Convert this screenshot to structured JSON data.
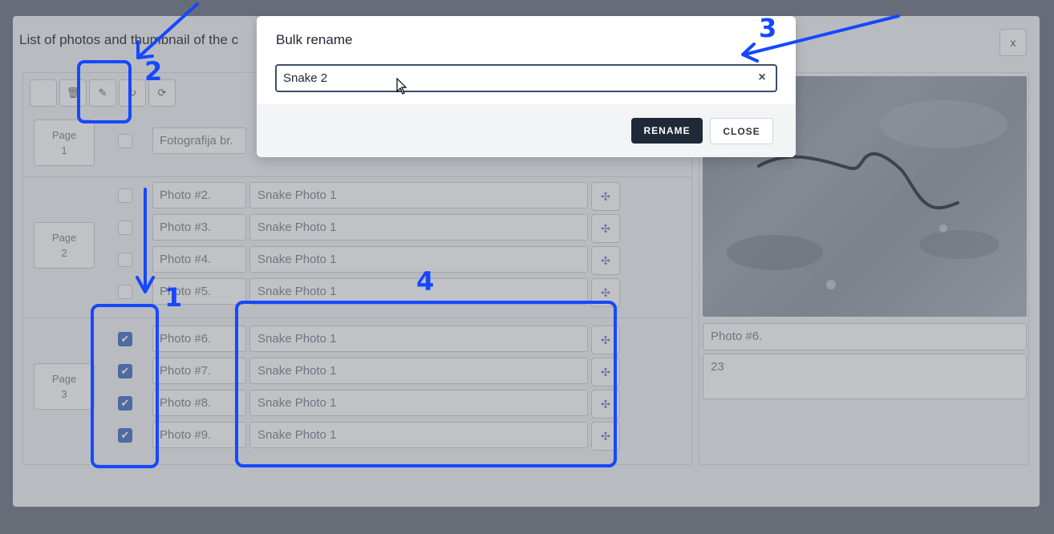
{
  "background_modal": {
    "title": "List of photos and thumbnail of the c",
    "close_label": "x",
    "toolbar_icons": [
      "blank",
      "trash-icon",
      "edit-icon",
      "rotate-icon",
      "refresh-icon"
    ],
    "header_row": {
      "photo_number_label": "Fotografija br."
    },
    "pages": [
      {
        "label_line1": "Page",
        "label_line2": "1"
      },
      {
        "label_line1": "Page",
        "label_line2": "2"
      },
      {
        "label_line1": "Page",
        "label_line2": "3"
      }
    ],
    "rows": [
      {
        "number": "Photo #2.",
        "name": "Snake Photo 1",
        "checked": false
      },
      {
        "number": "Photo #3.",
        "name": "Snake Photo 1",
        "checked": false
      },
      {
        "number": "Photo #4.",
        "name": "Snake Photo 1",
        "checked": false
      },
      {
        "number": "Photo #5.",
        "name": "Snake Photo 1",
        "checked": false
      },
      {
        "number": "Photo #6.",
        "name": "Snake Photo 1",
        "checked": true
      },
      {
        "number": "Photo #7.",
        "name": "Snake Photo 1",
        "checked": true
      },
      {
        "number": "Photo #8.",
        "name": "Snake Photo 1",
        "checked": true
      },
      {
        "number": "Photo #9.",
        "name": "Snake Photo 1",
        "checked": true
      }
    ],
    "preview": {
      "photo_field": "Photo #6.",
      "number_field": "23"
    }
  },
  "dialog": {
    "title": "Bulk rename",
    "input_value": "Snake 2",
    "clear_icon": "×",
    "rename_label": "RENAME",
    "close_label": "CLOSE"
  },
  "annotations": {
    "labels": [
      "1",
      "2",
      "3",
      "4"
    ],
    "color": "#1548ff"
  },
  "colors": {
    "primary_button": "#1f2937",
    "checkbox_checked": "#5b7cc9",
    "overlay": "#7d828c"
  }
}
